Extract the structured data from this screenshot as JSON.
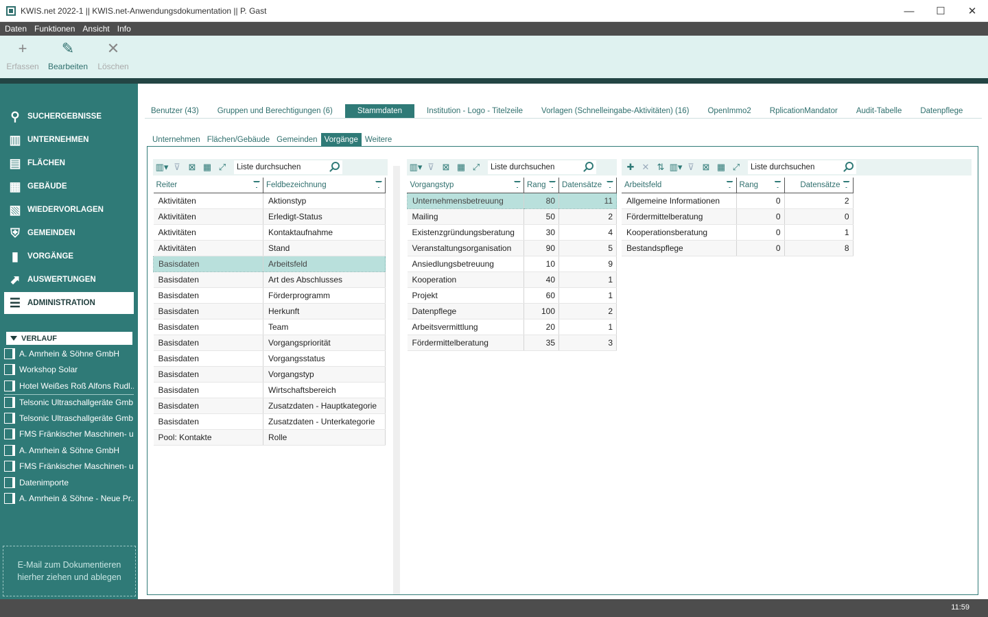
{
  "window": {
    "title": "KWIS.net 2022-1 || KWIS.net-Anwendungsdokumentation || P. Gast",
    "minimize": "—",
    "maximize": "☐",
    "close": "✕"
  },
  "menu": [
    "Daten",
    "Funktionen",
    "Ansicht",
    "Info"
  ],
  "toolbar": {
    "erfassen": {
      "label": "Erfassen",
      "icon": "plus-icon",
      "glyph": "+"
    },
    "bearbeiten": {
      "label": "Bearbeiten",
      "icon": "edit-document-icon",
      "glyph": "✎"
    },
    "loeschen": {
      "label": "Löschen",
      "icon": "delete-x-icon",
      "glyph": "✕"
    }
  },
  "sidebar": {
    "nav": [
      {
        "label": "SUCHERGEBNISSE",
        "icon": "search-icon",
        "glyph": "⚲"
      },
      {
        "label": "UNTERNEHMEN",
        "icon": "building-icon",
        "glyph": "▥"
      },
      {
        "label": "FLÄCHEN",
        "icon": "area-icon",
        "glyph": "▤"
      },
      {
        "label": "GEBÄUDE",
        "icon": "building-plan-icon",
        "glyph": "▦"
      },
      {
        "label": "WIEDERVORLAGEN",
        "icon": "reminder-icon",
        "glyph": "▧"
      },
      {
        "label": "GEMEINDEN",
        "icon": "shield-icon",
        "glyph": "⛨"
      },
      {
        "label": "VORGÄNGE",
        "icon": "process-icon",
        "glyph": "▮"
      },
      {
        "label": "AUSWERTUNGEN",
        "icon": "chart-icon",
        "glyph": "⬈"
      },
      {
        "label": "ADMINISTRATION",
        "icon": "settings-sliders-icon",
        "glyph": "☰"
      }
    ],
    "verlauf_title": "VERLAUF",
    "verlauf": [
      "A. Amrhein & Söhne GmbH",
      "Workshop Solar",
      "Hotel Weißes Roß Alfons Rudl...",
      "Telsonic Ultraschallgeräte Gmb...",
      "Telsonic Ultraschallgeräte Gmb...",
      "FMS Fränkischer Maschinen- u...",
      "A. Amrhein & Söhne GmbH",
      "FMS Fränkischer Maschinen- u...",
      "Datenimporte",
      "A. Amrhein & Söhne - Neue Pr..."
    ],
    "dropzone_line1": "E-Mail  zum Dokumentieren",
    "dropzone_line2": "hierher ziehen und ablegen"
  },
  "tabs_main": [
    "Benutzer (43)",
    "Gruppen und Berechtigungen (6)",
    "Stammdaten",
    "Institution - Logo - Titelzeile",
    "Vorlagen (Schnelleingabe-Aktivitäten) (16)",
    "OpenImmo2",
    "RplicationMandator",
    "Audit-Tabelle",
    "Datenpflege"
  ],
  "tabs_sub": [
    "Unternehmen",
    "Flächen/Gebäude",
    "Gemeinden",
    "Vorgänge",
    "Weitere"
  ],
  "search_placeholder": "Liste durchsuchen",
  "grid1": {
    "columns": [
      "Reiter",
      "Feldbezeichnung"
    ],
    "rows": [
      [
        "Aktivitäten",
        "Aktionstyp"
      ],
      [
        "Aktivitäten",
        "Erledigt-Status"
      ],
      [
        "Aktivitäten",
        "Kontaktaufnahme"
      ],
      [
        "Aktivitäten",
        "Stand"
      ],
      [
        "Basisdaten",
        "Arbeitsfeld"
      ],
      [
        "Basisdaten",
        "Art des Abschlusses"
      ],
      [
        "Basisdaten",
        "Förderprogramm"
      ],
      [
        "Basisdaten",
        "Herkunft"
      ],
      [
        "Basisdaten",
        "Team"
      ],
      [
        "Basisdaten",
        "Vorgangspriorität"
      ],
      [
        "Basisdaten",
        "Vorgangsstatus"
      ],
      [
        "Basisdaten",
        "Vorgangstyp"
      ],
      [
        "Basisdaten",
        "Wirtschaftsbereich"
      ],
      [
        "Basisdaten",
        "Zusatzdaten - Hauptkategorie"
      ],
      [
        "Basisdaten",
        "Zusatzdaten - Unterkategorie"
      ],
      [
        "Pool: Kontakte",
        "Rolle"
      ]
    ]
  },
  "grid2": {
    "columns": [
      "Vorgangstyp",
      "Rang",
      "Datensätze"
    ],
    "rows": [
      [
        "Unternehmensbetreuung",
        "80",
        "11"
      ],
      [
        "Mailing",
        "50",
        "2"
      ],
      [
        "Existenzgründungsberatung",
        "30",
        "4"
      ],
      [
        "Veranstaltungsorganisation",
        "90",
        "5"
      ],
      [
        "Ansiedlungsbetreuung",
        "10",
        "9"
      ],
      [
        "Kooperation",
        "40",
        "1"
      ],
      [
        "Projekt",
        "60",
        "1"
      ],
      [
        "Datenpflege",
        "100",
        "2"
      ],
      [
        "Arbeitsvermittlung",
        "20",
        "1"
      ],
      [
        "Fördermittelberatung",
        "35",
        "3"
      ]
    ]
  },
  "grid3": {
    "columns": [
      "Arbeitsfeld",
      "Rang",
      "Datensätze"
    ],
    "rows": [
      [
        "Allgemeine Informationen",
        "0",
        "2"
      ],
      [
        "Fördermittelberatung",
        "0",
        "0"
      ],
      [
        "Kooperationsberatung",
        "0",
        "1"
      ],
      [
        "Bestandspflege",
        "0",
        "8"
      ]
    ]
  },
  "status": {
    "clock": "11:59"
  }
}
